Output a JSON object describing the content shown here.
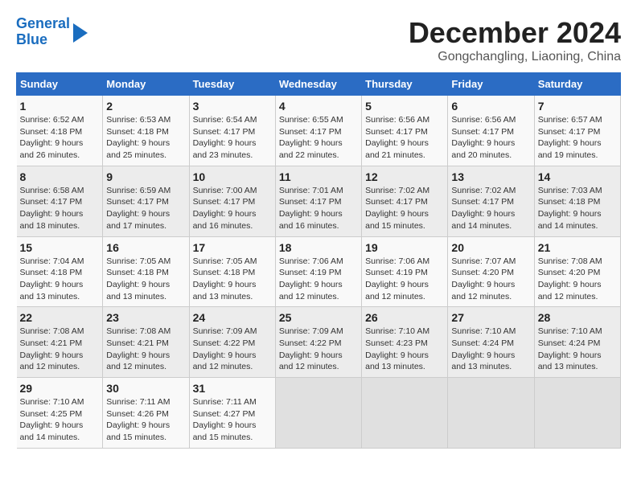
{
  "header": {
    "logo_line1": "General",
    "logo_line2": "Blue",
    "month_title": "December 2024",
    "location": "Gongchangling, Liaoning, China"
  },
  "weekdays": [
    "Sunday",
    "Monday",
    "Tuesday",
    "Wednesday",
    "Thursday",
    "Friday",
    "Saturday"
  ],
  "weeks": [
    [
      {
        "day": "1",
        "sunrise": "6:52 AM",
        "sunset": "4:18 PM",
        "daylight": "9 hours and 26 minutes."
      },
      {
        "day": "2",
        "sunrise": "6:53 AM",
        "sunset": "4:18 PM",
        "daylight": "9 hours and 25 minutes."
      },
      {
        "day": "3",
        "sunrise": "6:54 AM",
        "sunset": "4:17 PM",
        "daylight": "9 hours and 23 minutes."
      },
      {
        "day": "4",
        "sunrise": "6:55 AM",
        "sunset": "4:17 PM",
        "daylight": "9 hours and 22 minutes."
      },
      {
        "day": "5",
        "sunrise": "6:56 AM",
        "sunset": "4:17 PM",
        "daylight": "9 hours and 21 minutes."
      },
      {
        "day": "6",
        "sunrise": "6:56 AM",
        "sunset": "4:17 PM",
        "daylight": "9 hours and 20 minutes."
      },
      {
        "day": "7",
        "sunrise": "6:57 AM",
        "sunset": "4:17 PM",
        "daylight": "9 hours and 19 minutes."
      }
    ],
    [
      {
        "day": "8",
        "sunrise": "6:58 AM",
        "sunset": "4:17 PM",
        "daylight": "9 hours and 18 minutes."
      },
      {
        "day": "9",
        "sunrise": "6:59 AM",
        "sunset": "4:17 PM",
        "daylight": "9 hours and 17 minutes."
      },
      {
        "day": "10",
        "sunrise": "7:00 AM",
        "sunset": "4:17 PM",
        "daylight": "9 hours and 16 minutes."
      },
      {
        "day": "11",
        "sunrise": "7:01 AM",
        "sunset": "4:17 PM",
        "daylight": "9 hours and 16 minutes."
      },
      {
        "day": "12",
        "sunrise": "7:02 AM",
        "sunset": "4:17 PM",
        "daylight": "9 hours and 15 minutes."
      },
      {
        "day": "13",
        "sunrise": "7:02 AM",
        "sunset": "4:17 PM",
        "daylight": "9 hours and 14 minutes."
      },
      {
        "day": "14",
        "sunrise": "7:03 AM",
        "sunset": "4:18 PM",
        "daylight": "9 hours and 14 minutes."
      }
    ],
    [
      {
        "day": "15",
        "sunrise": "7:04 AM",
        "sunset": "4:18 PM",
        "daylight": "9 hours and 13 minutes."
      },
      {
        "day": "16",
        "sunrise": "7:05 AM",
        "sunset": "4:18 PM",
        "daylight": "9 hours and 13 minutes."
      },
      {
        "day": "17",
        "sunrise": "7:05 AM",
        "sunset": "4:18 PM",
        "daylight": "9 hours and 13 minutes."
      },
      {
        "day": "18",
        "sunrise": "7:06 AM",
        "sunset": "4:19 PM",
        "daylight": "9 hours and 12 minutes."
      },
      {
        "day": "19",
        "sunrise": "7:06 AM",
        "sunset": "4:19 PM",
        "daylight": "9 hours and 12 minutes."
      },
      {
        "day": "20",
        "sunrise": "7:07 AM",
        "sunset": "4:20 PM",
        "daylight": "9 hours and 12 minutes."
      },
      {
        "day": "21",
        "sunrise": "7:08 AM",
        "sunset": "4:20 PM",
        "daylight": "9 hours and 12 minutes."
      }
    ],
    [
      {
        "day": "22",
        "sunrise": "7:08 AM",
        "sunset": "4:21 PM",
        "daylight": "9 hours and 12 minutes."
      },
      {
        "day": "23",
        "sunrise": "7:08 AM",
        "sunset": "4:21 PM",
        "daylight": "9 hours and 12 minutes."
      },
      {
        "day": "24",
        "sunrise": "7:09 AM",
        "sunset": "4:22 PM",
        "daylight": "9 hours and 12 minutes."
      },
      {
        "day": "25",
        "sunrise": "7:09 AM",
        "sunset": "4:22 PM",
        "daylight": "9 hours and 12 minutes."
      },
      {
        "day": "26",
        "sunrise": "7:10 AM",
        "sunset": "4:23 PM",
        "daylight": "9 hours and 13 minutes."
      },
      {
        "day": "27",
        "sunrise": "7:10 AM",
        "sunset": "4:24 PM",
        "daylight": "9 hours and 13 minutes."
      },
      {
        "day": "28",
        "sunrise": "7:10 AM",
        "sunset": "4:24 PM",
        "daylight": "9 hours and 13 minutes."
      }
    ],
    [
      {
        "day": "29",
        "sunrise": "7:10 AM",
        "sunset": "4:25 PM",
        "daylight": "9 hours and 14 minutes."
      },
      {
        "day": "30",
        "sunrise": "7:11 AM",
        "sunset": "4:26 PM",
        "daylight": "9 hours and 15 minutes."
      },
      {
        "day": "31",
        "sunrise": "7:11 AM",
        "sunset": "4:27 PM",
        "daylight": "9 hours and 15 minutes."
      },
      {
        "day": "",
        "sunrise": "",
        "sunset": "",
        "daylight": ""
      },
      {
        "day": "",
        "sunrise": "",
        "sunset": "",
        "daylight": ""
      },
      {
        "day": "",
        "sunrise": "",
        "sunset": "",
        "daylight": ""
      },
      {
        "day": "",
        "sunrise": "",
        "sunset": "",
        "daylight": ""
      }
    ]
  ]
}
